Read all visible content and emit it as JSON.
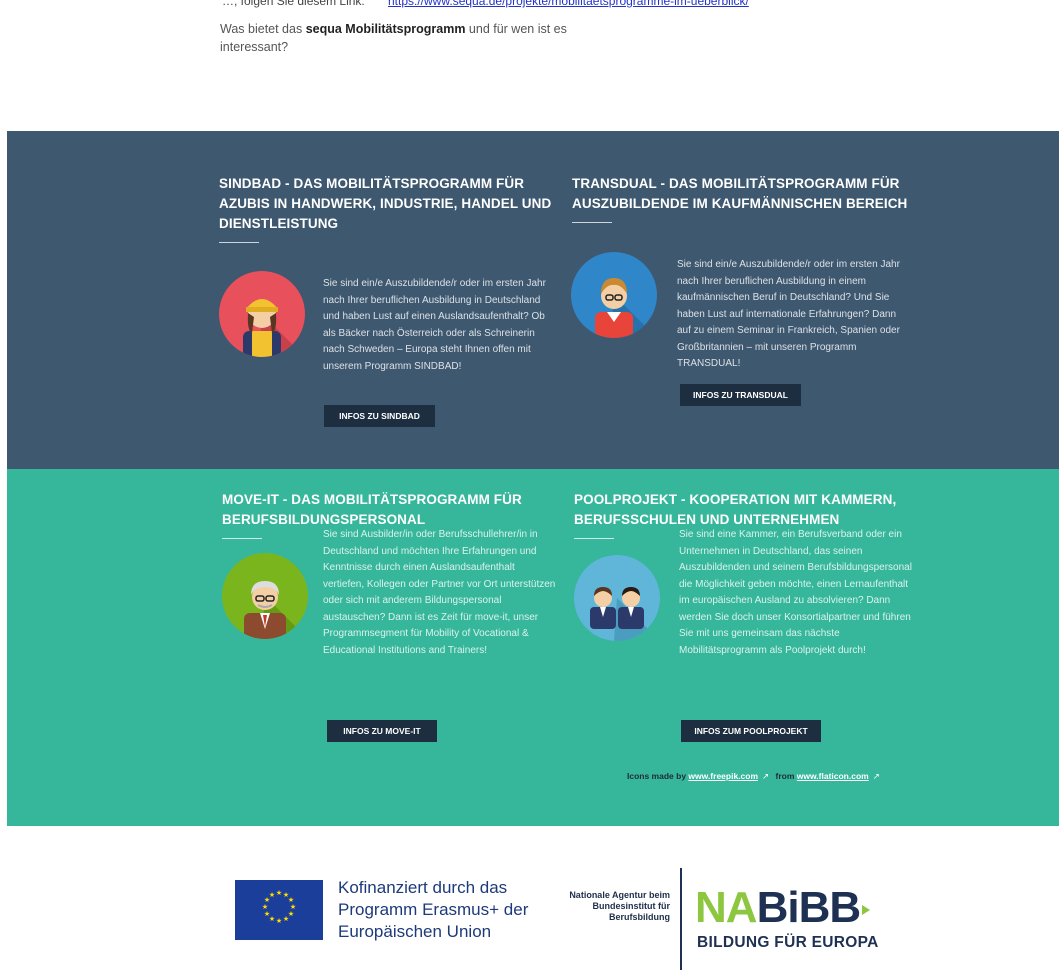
{
  "top_link": {
    "prefix": "…, folgen Sie diesem Link:",
    "url_text": "https://www.sequa.de/projekte/mobilitaetsprogramme-im-ueberblick/"
  },
  "intro": {
    "before": "Was bietet das ",
    "bold": "sequa Mobilitätsprogramm",
    "after": " und für wen ist es interessant?"
  },
  "cards": {
    "sindbad": {
      "title": "SINDBAD - DAS MOBILITÄTSPROGRAMM FÜR AZUBIS IN HANDWERK, INDUSTRIE, HANDEL UND DIENSTLEISTUNG",
      "text": "Sie sind ein/e Auszubildende/r oder im ersten Jahr nach Ihrer beruflichen Ausbildung in Deutschland und haben Lust auf einen Auslandsaufenthalt? Ob als Bäcker nach Österreich oder als Schreinerin nach Schweden – Europa steht Ihnen offen mit unserem Programm SINDBAD!",
      "button": "INFOS ZU SINDBAD",
      "avatar_icon": "craftswoman-avatar-icon",
      "avatar_color": "#e8505b"
    },
    "transdual": {
      "title": "TRANSDUAL - DAS MOBILITÄTSPROGRAMM FÜR AUSZUBILDENDE IM KAUFMÄNNISCHEN BEREICH",
      "text": "Sie sind ein/e Auszubildende/r oder im ersten Jahr nach Ihrer beruflichen Ausbildung in einem kaufmännischen Beruf in Deutschland? Und Sie haben Lust auf internationale Erfahrungen? Dann auf zu einem Seminar in Frankreich, Spanien oder Großbritannien – mit unseren Programm TRANSDUAL!",
      "button": "INFOS ZU TRANSDUAL",
      "avatar_icon": "office-trainee-avatar-icon",
      "avatar_color": "#2f86c9"
    },
    "moveit": {
      "title": "MOVE-IT - DAS MOBILITÄTSPROGRAMM FÜR BERUFSBILDUNGSPERSONAL",
      "text": "Sie sind Ausbilder/in oder Berufsschullehrer/in in Deutschland und möchten Ihre Erfahrungen und Kenntnisse durch einen Auslandsaufenthalt vertiefen, Kollegen oder Partner vor Ort unterstützen oder sich mit anderem Bildungspersonal austauschen? Dann ist es Zeit für move-it, unser Programmsegment für Mobility of Vocational & Educational Institutions and Trainers!",
      "button": "INFOS ZU MOVE-IT",
      "avatar_icon": "teacher-avatar-icon",
      "avatar_color": "#7ab51d"
    },
    "pool": {
      "title": "POOLPROJEKT - KOOPERATION MIT KAMMERN, BERUFSSCHULEN UND UNTERNEHMEN",
      "text": "Sie sind eine Kammer, ein Berufsverband oder ein Unternehmen in Deutschland, das seinen Auszubildenden und seinem Berufsbildungspersonal die Möglichkeit geben möchte, einen Lernaufenthalt im europäischen Ausland zu absolvieren? Dann werden Sie doch unser Konsortialpartner und führen Sie mit uns gemeinsam das nächste Mobilitätsprogramm als Poolprojekt durch!",
      "button": "INFOS ZUM POOLPROJEKT",
      "avatar_icon": "business-people-avatar-icon",
      "avatar_color": "#5fb6d8"
    }
  },
  "credit": {
    "prefix": "Icons made by ",
    "link1": "www.freepik.com",
    "middle": " from ",
    "link2": "www.flaticon.com",
    "ext": "↗"
  },
  "footer": {
    "eu_text": "Kofinanziert durch das Programm Erasmus+ der Europäischen Union",
    "na_text": "Nationale Agentur beim Bundesinstitut für Berufsbildung",
    "logo_na": "NA",
    "logo_bibb": "BiBB",
    "logo_sub": "BILDUNG FÜR EUROPA"
  },
  "colors": {
    "dark_band": "#3e5870",
    "teal_band": "#36b79b",
    "button_bg": "#1c2e40",
    "nabibb_green": "#8dc63f",
    "nabibb_navy": "#1f3152",
    "eu_blue": "#1b3e9a"
  }
}
